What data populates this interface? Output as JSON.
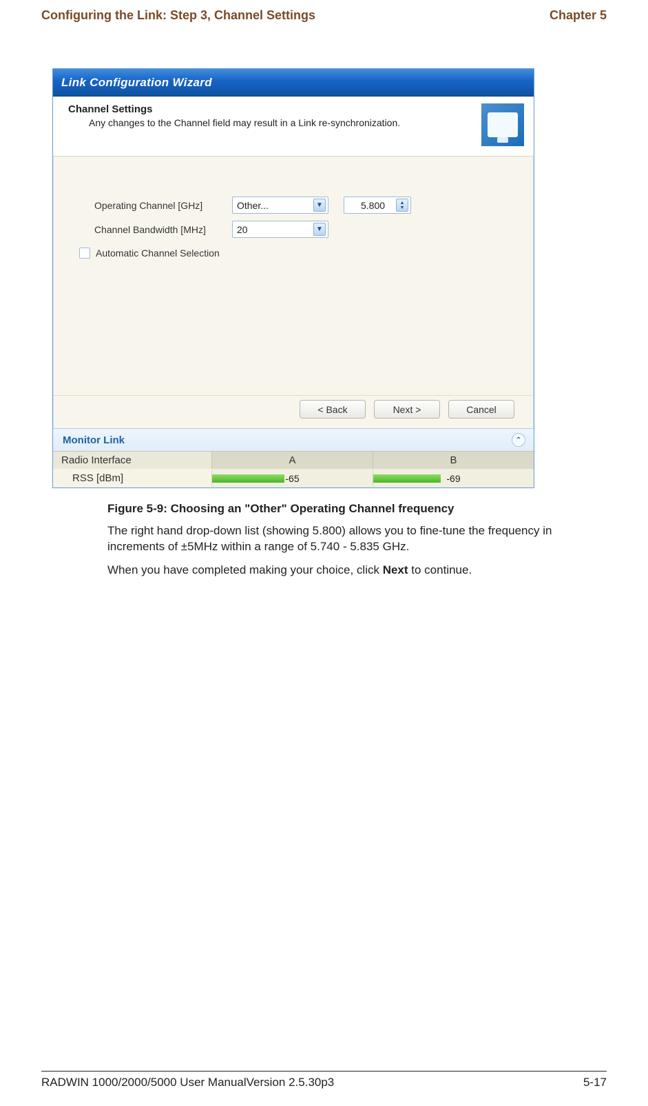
{
  "header": {
    "left": "Configuring the Link: Step 3, Channel Settings",
    "right": "Chapter 5"
  },
  "wizard": {
    "title": "Link Configuration Wizard",
    "section_title": "Channel Settings",
    "section_desc": "Any changes to the Channel field may result in a Link re-synchronization.",
    "fields": {
      "operating_channel_label": "Operating Channel [GHz]",
      "operating_channel_value": "Other...",
      "operating_channel_freq": "5.800",
      "bandwidth_label": "Channel Bandwidth [MHz]",
      "bandwidth_value": "20",
      "acs_label": "Automatic Channel Selection"
    },
    "buttons": {
      "back": "< Back",
      "next": "Next >",
      "cancel": "Cancel"
    },
    "monitor": {
      "title": "Monitor Link",
      "row_title": "Radio Interface",
      "col_a": "A",
      "col_b": "B",
      "rss_label": "RSS [dBm]",
      "rss_a": "-65",
      "rss_b": "-69"
    }
  },
  "caption": {
    "title": "Figure 5-9: Choosing an \"Other\" Operating Channel frequency",
    "p1_a": "The right hand drop-down list (showing 5.800) allows you to fine-tune the frequency in increments of ±5MHz within a range of 5.740 - 5.835 GHz.",
    "p2_a": "When you have completed making your choice, click ",
    "p2_bold": "Next",
    "p2_b": " to continue."
  },
  "footer": {
    "left": "RADWIN 1000/2000/5000 User ManualVersion  2.5.30p3",
    "right": "5-17"
  }
}
